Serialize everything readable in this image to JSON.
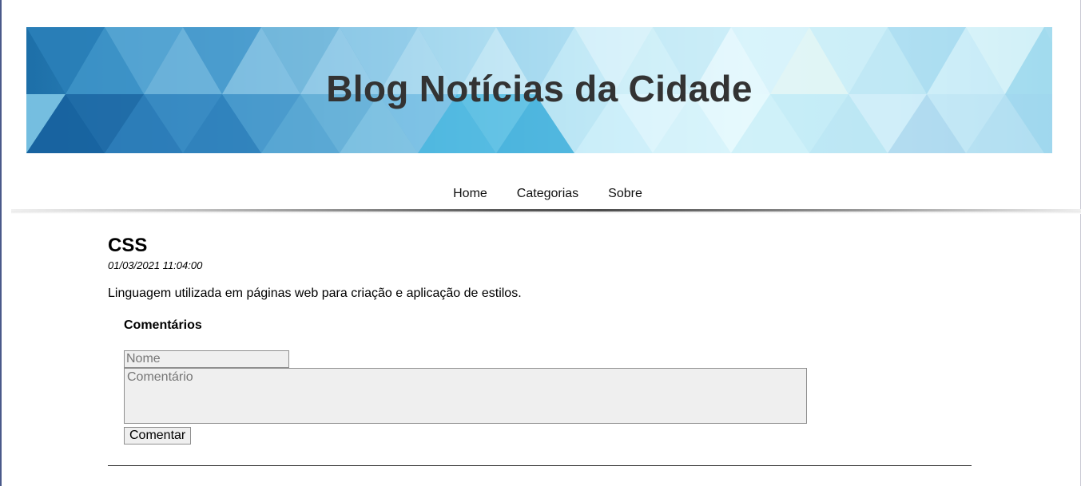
{
  "header": {
    "title": "Blog Notícias da Cidade"
  },
  "nav": {
    "items": [
      {
        "label": "Home"
      },
      {
        "label": "Categorias"
      },
      {
        "label": "Sobre"
      }
    ]
  },
  "post": {
    "title": "CSS",
    "date": "01/03/2021 11:04:00",
    "body": "Linguagem utilizada em páginas web para criação e aplicação de estilos."
  },
  "comments": {
    "heading": "Comentários",
    "name_placeholder": "Nome",
    "comment_placeholder": "Comentário",
    "submit_label": "Comentar"
  },
  "colors": {
    "title_text": "#333333",
    "banner_dark": "#1d6fa8",
    "banner_light": "#d9f3fb"
  }
}
